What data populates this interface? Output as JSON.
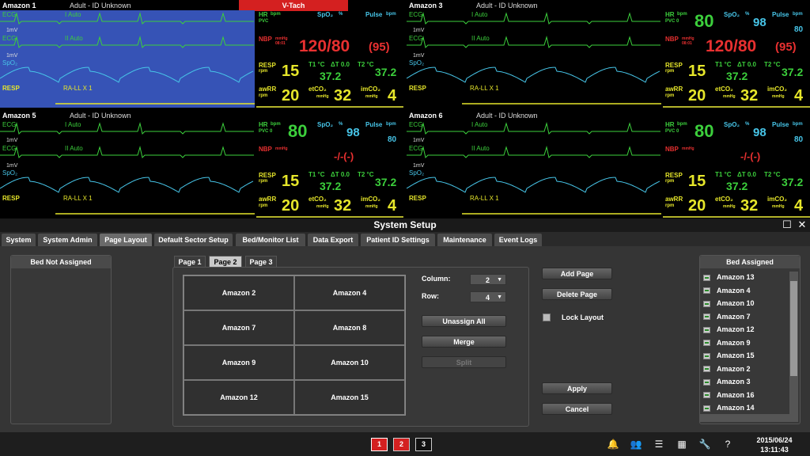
{
  "monitors": [
    {
      "name": "Amazon 1",
      "patient": "Adult - ID Unknown",
      "alarm": "V-Tach",
      "highlight": true,
      "nbp": "120/80",
      "map": "(95)",
      "nbp_unit": "mmHg",
      "nbp_time": "08:01",
      "hr": "",
      "pvc": "PVC",
      "spo2": "",
      "pulse": "",
      "resp": "15",
      "t1": "37.2",
      "dt": "ΔT 0.0",
      "t2": "37.2",
      "awrr": "20",
      "etco2": "32",
      "imco2": "4"
    },
    {
      "name": "Amazon 3",
      "patient": "Adult - ID Unknown",
      "alarm": "",
      "highlight": false,
      "nbp": "120/80",
      "map": "(95)",
      "nbp_unit": "mmHg",
      "nbp_time": "08:01",
      "hr": "80",
      "pvc": "PVC 0",
      "spo2": "98",
      "pulse": "80",
      "resp": "15",
      "t1": "37.2",
      "dt": "ΔT 0.0",
      "t2": "37.2",
      "awrr": "20",
      "etco2": "32",
      "imco2": "4"
    },
    {
      "name": "Amazon 5",
      "patient": "Adult - ID Unknown",
      "alarm": "",
      "highlight": false,
      "nbp": "-/-(-)",
      "map": "",
      "nbp_unit": "mmHg",
      "nbp_time": "",
      "hr": "80",
      "pvc": "PVC 0",
      "spo2": "98",
      "pulse": "80",
      "resp": "15",
      "t1": "37.2",
      "dt": "ΔT 0.0",
      "t2": "37.2",
      "awrr": "20",
      "etco2": "32",
      "imco2": "4"
    },
    {
      "name": "Amazon 6",
      "patient": "Adult - ID Unknown",
      "alarm": "",
      "highlight": false,
      "nbp": "-/-(-)",
      "map": "",
      "nbp_unit": "mmHg",
      "nbp_time": "",
      "hr": "80",
      "pvc": "PVC 0",
      "spo2": "98",
      "pulse": "80",
      "resp": "15",
      "t1": "37.2",
      "dt": "ΔT 0.0",
      "t2": "37.2",
      "awrr": "20",
      "etco2": "32",
      "imco2": "4"
    }
  ],
  "labels": {
    "ecg": "ECG",
    "ecg1": "I",
    "ecg2": "II",
    "auto": "Auto",
    "onemv": "1mV",
    "spo2wave": "SpO₂",
    "resp": "RESP",
    "rall": "RA-LL X 1",
    "hr": "HR",
    "bpm": "bpm",
    "spo2": "SpO₂",
    "pct": "%",
    "pulse": "Pulse",
    "nbp": "NBP",
    "respp": "RESP",
    "rpm": "rpm",
    "t1": "T1 °C",
    "t2": "T2 °C",
    "awrr": "awRR",
    "etco2": "etCO₂",
    "imco2": "imCO₂",
    "mmhg": "mmHg"
  },
  "setup": {
    "title": "System Setup",
    "tabs": [
      "System",
      "System Admin",
      "Page Layout",
      "Default Sector Setup",
      "Bed/Monitor List",
      "Data Export",
      "Patient ID Settings",
      "Maintenance",
      "Event Logs"
    ],
    "active_tab": "Page Layout",
    "bed_not_assigned": "Bed Not Assigned",
    "pages": [
      "Page 1",
      "Page 2",
      "Page 3"
    ],
    "grid": [
      "Amazon 2",
      "Amazon 4",
      "Amazon 7",
      "Amazon 8",
      "Amazon 9",
      "Amazon 10",
      "Amazon 12",
      "Amazon 15"
    ],
    "column_label": "Column:",
    "column_value": "2",
    "row_label": "Row:",
    "row_value": "4",
    "unassign_all": "Unassign All",
    "merge": "Merge",
    "split": "Split",
    "add_page": "Add Page",
    "delete_page": "Delete Page",
    "lock_layout": "Lock Layout",
    "apply": "Apply",
    "cancel": "Cancel",
    "bed_assigned": "Bed Assigned",
    "assigned": [
      "Amazon 13",
      "Amazon 4",
      "Amazon 10",
      "Amazon 7",
      "Amazon 12",
      "Amazon 9",
      "Amazon 15",
      "Amazon 2",
      "Amazon 3",
      "Amazon 16",
      "Amazon 14"
    ]
  },
  "footer": {
    "pages": [
      "1",
      "2",
      "3"
    ],
    "date": "2015/06/24",
    "time": "13:11:43"
  },
  "colors": {
    "ecg": "#3ccf3c",
    "spo2": "#47c5e8",
    "resp": "#e6e62a",
    "nbp": "#e83030",
    "alarm": "#d42020",
    "highlight": "#3653b6"
  }
}
